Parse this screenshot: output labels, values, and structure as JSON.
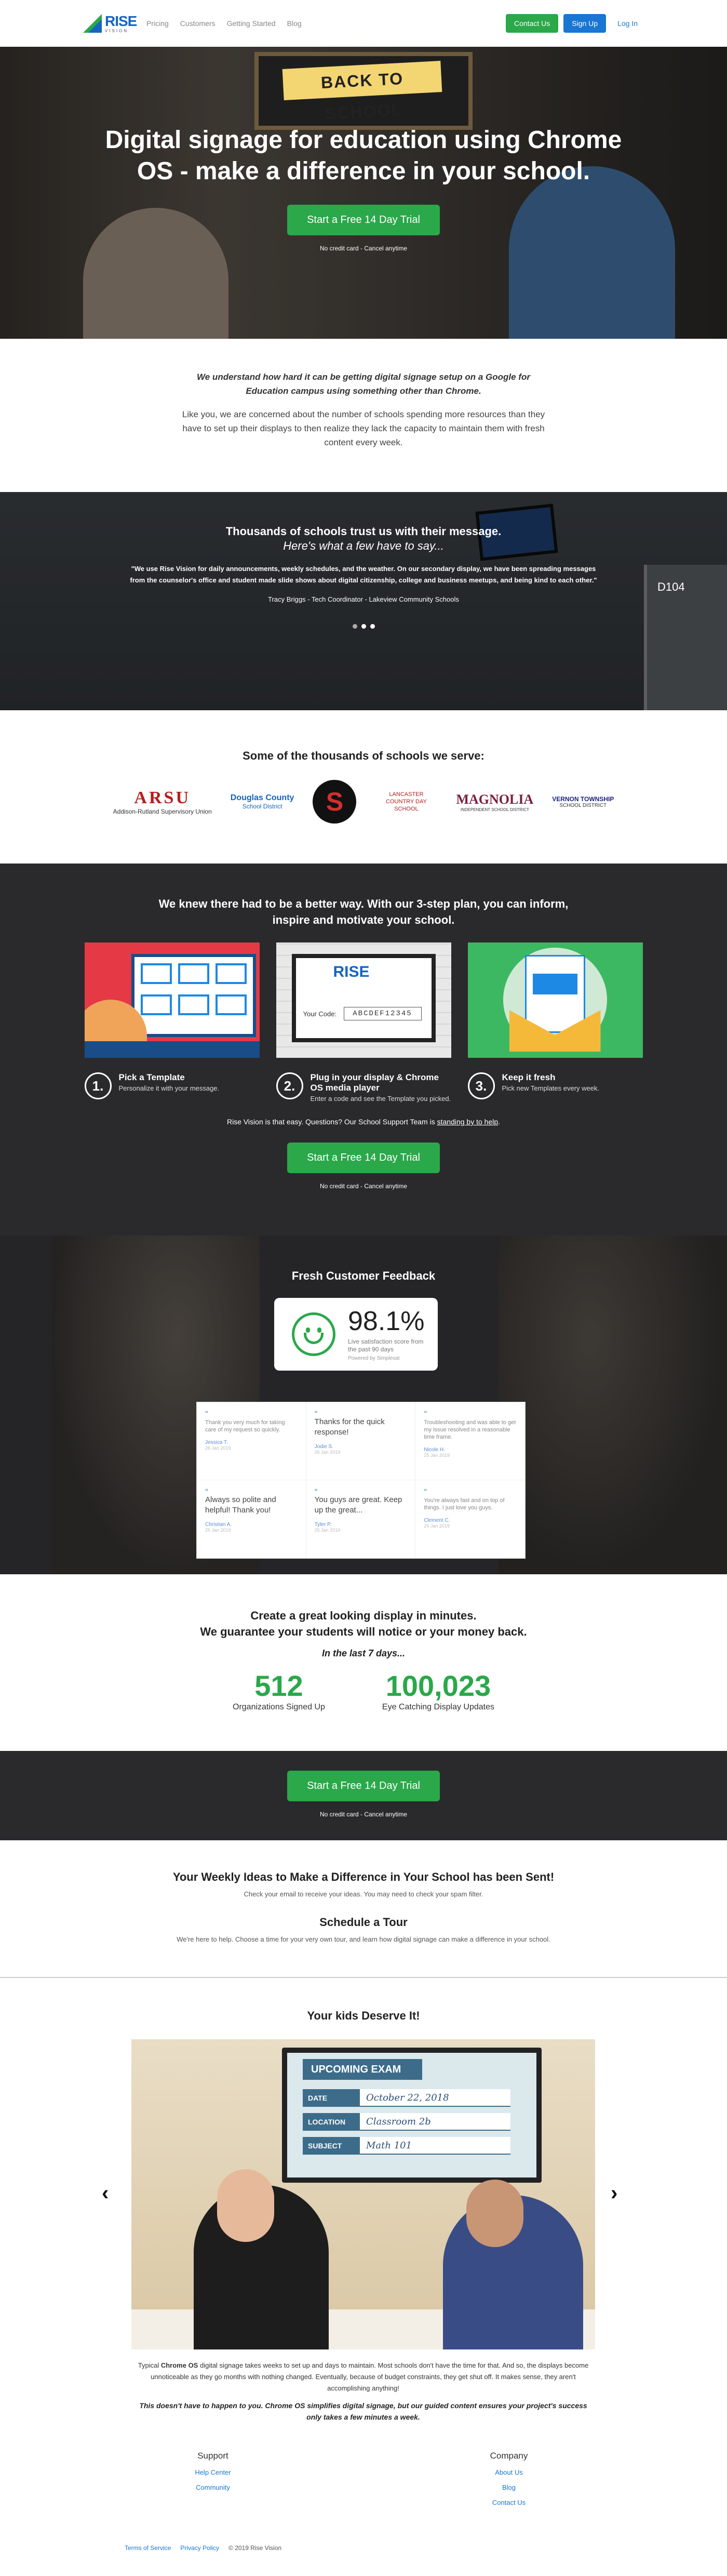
{
  "nav": {
    "logo_text": "RISE",
    "logo_sub": "VISION",
    "links": [
      "Pricing",
      "Customers",
      "Getting Started",
      "Blog"
    ],
    "contact": "Contact Us",
    "signup": "Sign Up",
    "login": "Log In"
  },
  "hero": {
    "sign": "BACK TO SCHOOL",
    "title": "Digital signage for education using Chrome OS - make a difference in your school.",
    "cta": "Start a Free 14 Day Trial",
    "sub": "No credit card - Cancel anytime"
  },
  "intro": {
    "lead": "We understand how hard it can be getting digital signage setup on a Google for Education campus using something other than Chrome.",
    "body": "Like you, we are concerned about the number of schools spending more resources than they have to set up their displays to then realize they lack the capacity to maintain them with fresh content every week."
  },
  "testimonial": {
    "title": "Thousands of schools trust us with their message.",
    "subtitle": "Here's what a few have to say...",
    "quote": "\"We use Rise Vision for daily announcements, weekly schedules, and the weather. On our secondary display, we have been spreading messages from the counselor's office and student made slide shows about digital citizenship, college and business meetups, and being kind to each other.\"",
    "author": "Tracy Briggs - Tech Coordinator - Lakeview Community Schools",
    "door_label": "D104"
  },
  "schools": {
    "title": "Some of the thousands of schools we serve:",
    "logos": [
      {
        "name": "ARSU",
        "sub": "Addison-Rutland Supervisory Union"
      },
      {
        "name": "Douglas County",
        "sub": "School District"
      },
      {
        "name": "S",
        "sub": ""
      },
      {
        "name": "LANCASTER COUNTRY DAY SCHOOL",
        "sub": ""
      },
      {
        "name": "MAGNOLIA",
        "sub": "INDEPENDENT SCHOOL DISTRICT"
      },
      {
        "name": "VERNON TOWNSHIP",
        "sub": "SCHOOL DISTRICT"
      }
    ]
  },
  "plan": {
    "title": "We knew there had to be a better way. With our 3-step plan, you can inform, inspire and motivate your school.",
    "code_label": "Your Code:",
    "code": "ABCDEF12345",
    "steps": [
      {
        "num": "1.",
        "title": "Pick a Template",
        "desc": "Personalize it with your message."
      },
      {
        "num": "2.",
        "title": "Plug in your display & Chrome OS media player",
        "desc": "Enter a code and see the Template you picked."
      },
      {
        "num": "3.",
        "title": "Keep it fresh",
        "desc": "Pick new Templates every week."
      }
    ],
    "support_pre": "Rise Vision is that easy. Questions? Our School Support Team is ",
    "support_link": "standing by to help",
    "support_post": ".",
    "cta": "Start a Free 14 Day Trial",
    "sub": "No credit card - Cancel anytime"
  },
  "feedback": {
    "title": "Fresh Customer Feedback",
    "score": "98.1%",
    "note": "Live satisfaction score from the past 90 days",
    "by": "Powered by Simplesat",
    "items": [
      {
        "text": "Thank you very much for taking care of my request so quickly.",
        "big": false,
        "name": "Jessica T.",
        "date": "26 Jan 2019"
      },
      {
        "text": "Thanks for the quick response!",
        "big": true,
        "name": "Jodie S.",
        "date": "26 Jan 2019"
      },
      {
        "text": "Troubleshooting and was able to get my issue resolved in a reasonable time frame.",
        "big": false,
        "name": "Nicole H.",
        "date": "25 Jan 2019"
      },
      {
        "text": "Always so polite and helpful! Thank you!",
        "big": true,
        "name": "Christian A.",
        "date": "25 Jan 2019"
      },
      {
        "text": "You guys are great. Keep up the great...",
        "big": true,
        "name": "Tyler P.",
        "date": "25 Jan 2019"
      },
      {
        "text": "You're always fast and on top of things. I just love you guys.",
        "big": false,
        "name": "Clement C.",
        "date": "24 Jan 2019"
      }
    ]
  },
  "stats": {
    "title_line1": "Create a great looking display in minutes.",
    "title_line2": "We guarantee your students will notice or your money back.",
    "period": "In the last 7 days...",
    "items": [
      {
        "value": "512",
        "label": "Organizations Signed Up"
      },
      {
        "value": "100,023",
        "label": "Eye Catching Display Updates"
      }
    ]
  },
  "cta_band": {
    "cta": "Start a Free 14 Day Trial",
    "sub": "No credit card - Cancel anytime"
  },
  "sent": {
    "title": "Your Weekly Ideas to Make a Difference in Your School has been Sent!",
    "text": "Check your email to receive your ideas. You may need to check your spam filter.",
    "tour_title": "Schedule a Tour",
    "tour_text": "We're here to help. Choose a time for your very own tour, and learn how digital signage can make a difference in your school."
  },
  "kids": {
    "title": "Your kids Deserve It!",
    "screen_title": "UPCOMING EXAM",
    "screen_rows": [
      {
        "k": "DATE",
        "v": "October 22, 2018"
      },
      {
        "k": "LOCATION",
        "v": "Classroom 2b"
      },
      {
        "k": "SUBJECT",
        "v": "Math 101"
      }
    ],
    "prev": "‹",
    "next": "›",
    "text_pre": "Typical ",
    "text_bold": "Chrome OS",
    "text_post": " digital signage takes weeks to set up and days to maintain. Most schools don't have the time for that. And so, the displays become unnoticeable as they go months with nothing changed. Eventually, because of budget constraints, they get shut off. It makes sense, they aren't accomplishing anything!",
    "emphasis": "This doesn't have to happen to you. Chrome OS simplifies digital signage, but our guided content ensures your project's success only takes a few minutes a week."
  },
  "footer": {
    "support_title": "Support",
    "support_links": [
      "Help Center",
      "Community"
    ],
    "company_title": "Company",
    "company_links": [
      "About Us",
      "Blog",
      "Contact Us"
    ],
    "bottom": [
      "Terms of Service",
      "Privacy Policy",
      "© 2019 Rise Vision"
    ]
  },
  "colors": {
    "green": "#2ba84a",
    "blue": "#1976d2",
    "dark": "#2a2a2d"
  }
}
